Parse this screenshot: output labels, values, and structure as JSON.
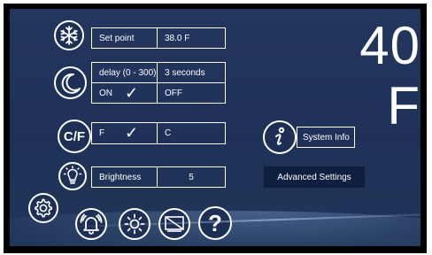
{
  "temperature": {
    "display": "40 F"
  },
  "setpoint": {
    "label": "Set point",
    "value": "38.0 F"
  },
  "delay": {
    "label": "delay (0 - 300)",
    "value": "3 seconds",
    "on_label": "ON",
    "off_label": "OFF",
    "selected": "ON"
  },
  "units": {
    "icon_text": "C/F",
    "fahrenheit_label": "F",
    "celsius_label": "C",
    "selected": "F"
  },
  "brightness": {
    "label": "Brightness",
    "value": "5"
  },
  "system_info": {
    "label": "System Info"
  },
  "advanced_settings": {
    "label": "Advanced Settings"
  },
  "bottom_icons": [
    "gear-icon",
    "alarm-bell-icon",
    "sun-icon",
    "display-icon",
    "help-icon"
  ],
  "help_glyph": "?",
  "check_glyph": "✓",
  "colors": {
    "background": "#23365e",
    "button_dark": "#0f1f40",
    "foreground": "#ffffff"
  }
}
